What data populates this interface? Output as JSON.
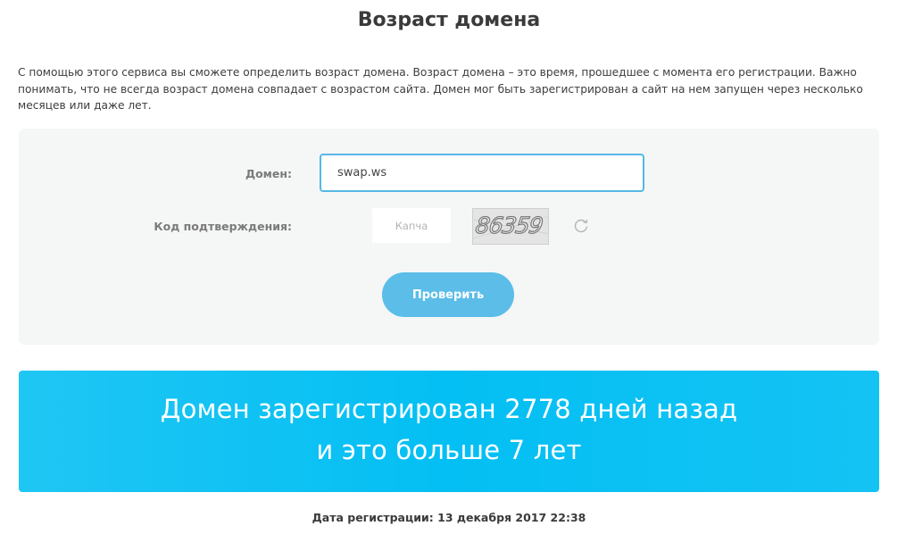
{
  "page": {
    "title": "Возраст домена",
    "intro": "С помощью этого сервиса вы сможете определить возраст домена. Возраст домена – это время, прошедшее с момента его регистрации. Важно понимать, что не всегда возраст домена совпадает с возрастом сайта. Домен мог быть зарегистрирован а сайт на нем запущен через несколько месяцев или даже лет."
  },
  "form": {
    "domain_label": "Домен:",
    "domain_value": "swap.ws",
    "code_label": "Код подтверждения:",
    "captcha_placeholder": "Капча",
    "captcha_code": "86359",
    "refresh_icon": "refresh-icon",
    "submit_label": "Проверить"
  },
  "result": {
    "line1": "Домен зарегистрирован 2778 дней назад",
    "line2": "и это больше 7 лет",
    "registration_date": "Дата регистрации: 13 декабря 2017 22:38"
  },
  "colors": {
    "accent": "#5bbde8",
    "banner": "#04bff3",
    "panel_bg": "#f5f6f6"
  }
}
